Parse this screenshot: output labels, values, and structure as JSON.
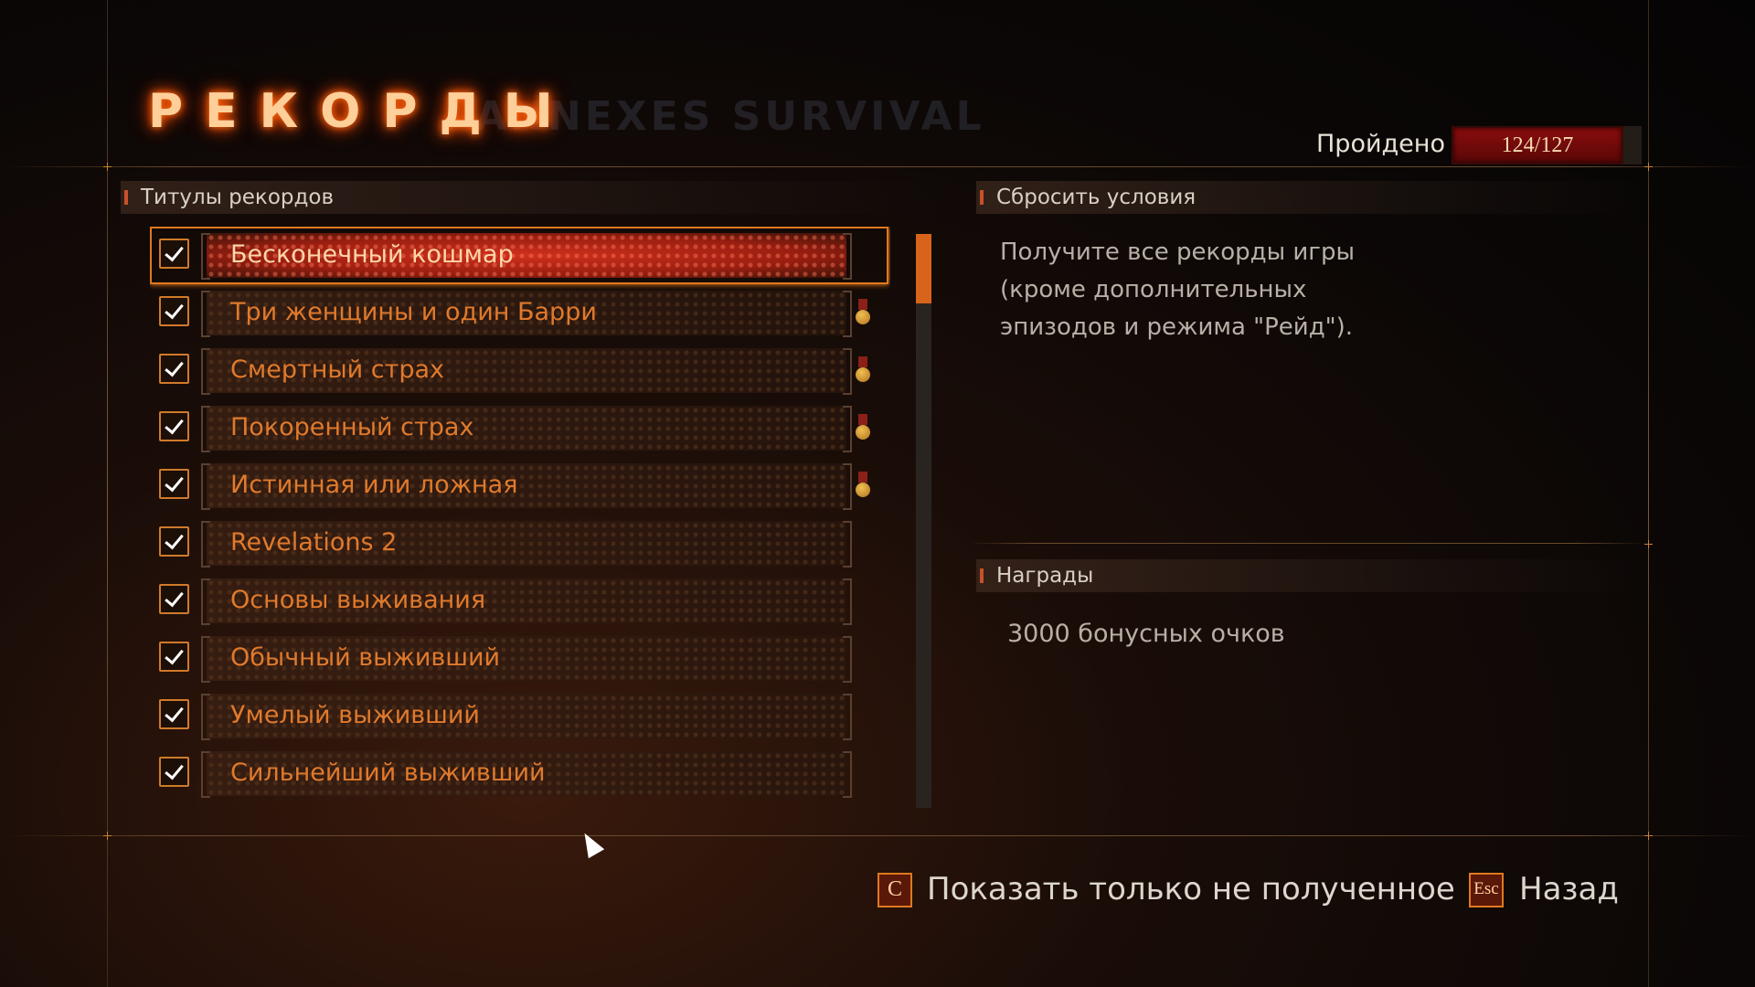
{
  "title": "РЕКОРДЫ",
  "title_ghost": "ANNEXES SURVIVAL",
  "progress": {
    "label": "Пройдено",
    "value": "124/127"
  },
  "list_section": {
    "header": "Титулы рекордов",
    "items": [
      {
        "label": "Бесконечный кошмар",
        "checked": true,
        "medal": false,
        "selected": true
      },
      {
        "label": "Три женщины и один Барри",
        "checked": true,
        "medal": true,
        "selected": false
      },
      {
        "label": "Смертный страх",
        "checked": true,
        "medal": true,
        "selected": false
      },
      {
        "label": "Покоренный страх",
        "checked": true,
        "medal": true,
        "selected": false
      },
      {
        "label": "Истинная или ложная",
        "checked": true,
        "medal": true,
        "selected": false
      },
      {
        "label": "Revelations 2",
        "checked": true,
        "medal": false,
        "selected": false
      },
      {
        "label": "Основы выживания",
        "checked": true,
        "medal": false,
        "selected": false
      },
      {
        "label": "Обычный выживший",
        "checked": true,
        "medal": false,
        "selected": false
      },
      {
        "label": "Умелый выживший",
        "checked": true,
        "medal": false,
        "selected": false
      },
      {
        "label": "Сильнейший выживший",
        "checked": true,
        "medal": false,
        "selected": false
      }
    ]
  },
  "condition_section": {
    "header": "Сбросить условия",
    "text_lines": [
      "Получите все рекорды игры",
      "(кроме дополнительных",
      "эпизодов и режима \"Рейд\")."
    ]
  },
  "reward_section": {
    "header": "Награды",
    "text": "3000 бонусных очков"
  },
  "footer": {
    "filter_key": "C",
    "filter_label": "Показать только не полученное",
    "back_key": "Esc",
    "back_label": "Назад"
  },
  "colors": {
    "accent": "#e07820",
    "item_text": "#e07a2c",
    "progress_bg": "#8a0d0d"
  }
}
